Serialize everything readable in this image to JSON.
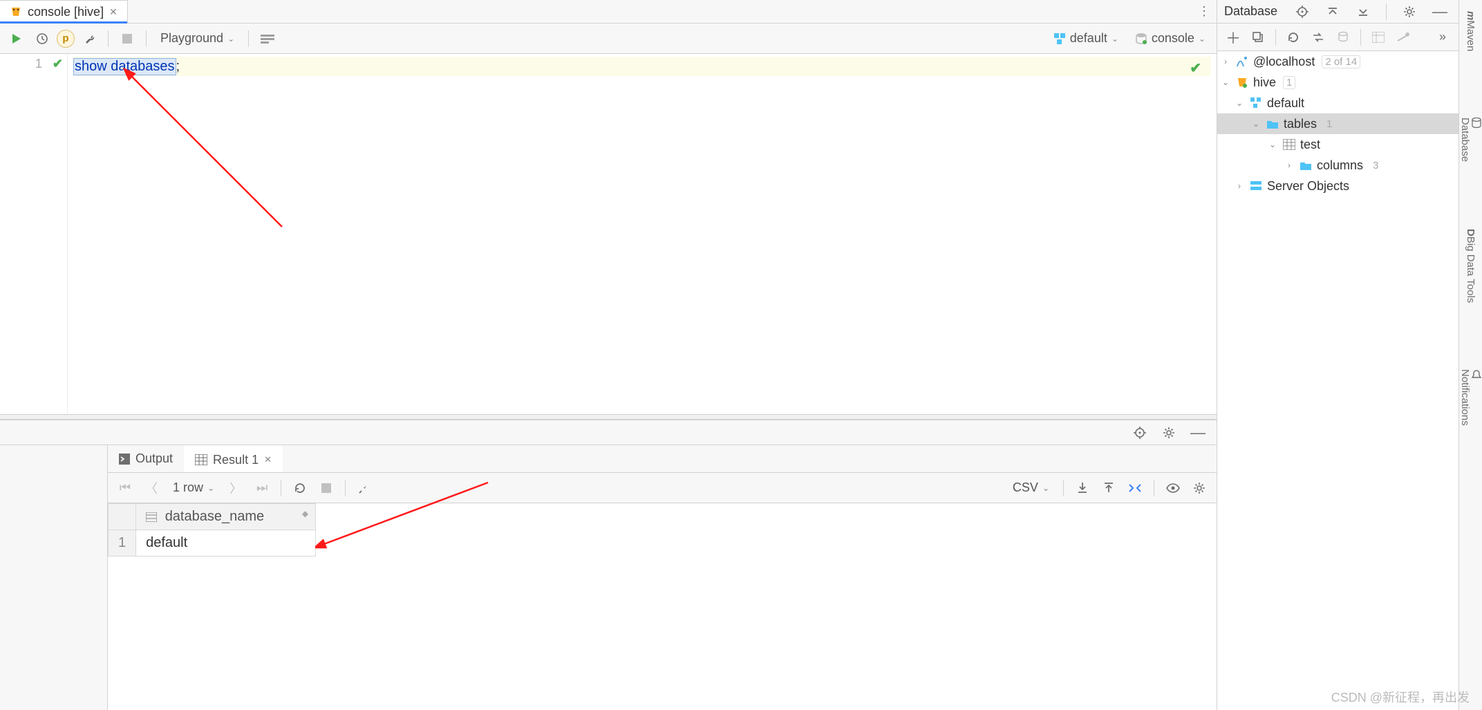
{
  "tab": {
    "title": "console [hive]"
  },
  "toolbar": {
    "playground": "Playground",
    "schema": "default",
    "session": "console"
  },
  "editor": {
    "line_no": "1",
    "code_selected": "show databases",
    "code_rest": "  ;"
  },
  "results": {
    "tabs": {
      "output": "Output",
      "result": "Result 1"
    },
    "row_info": "1 row",
    "export_fmt": "CSV",
    "col_header": "database_name",
    "rows": [
      {
        "n": "1",
        "v": "default"
      }
    ]
  },
  "db_panel": {
    "title": "Database",
    "tree": {
      "local": {
        "label": "@localhost",
        "count": "2 of 14"
      },
      "hive": {
        "label": "hive",
        "count": "1"
      },
      "schema": {
        "label": "default"
      },
      "tables": {
        "label": "tables",
        "count": "1"
      },
      "table": {
        "label": "test"
      },
      "columns": {
        "label": "columns",
        "count": "3"
      },
      "server_objects": {
        "label": "Server Objects"
      }
    }
  },
  "far_tabs": {
    "maven": "Maven",
    "database": "Database",
    "bigdata": "Big Data Tools",
    "notif": "Notifications"
  },
  "watermark": "CSDN @新征程，再出发"
}
